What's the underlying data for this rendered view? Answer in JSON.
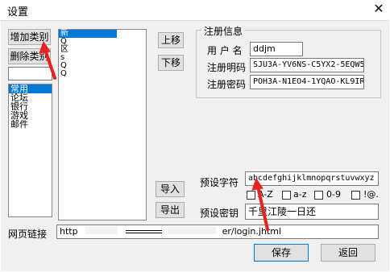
{
  "window": {
    "title": "设置",
    "close_glyph": "✕"
  },
  "buttons": {
    "add_category": "增加类别",
    "delete_category": "删除类别",
    "move_up": "上移",
    "move_down": "下移",
    "import": "导入",
    "export": "导出",
    "save": "保存",
    "back": "返回"
  },
  "categories": [
    "常用",
    "论坛",
    "银行",
    "游戏",
    "邮件"
  ],
  "site_list": {
    "items": [
      "新",
      "Q",
      "区",
      "s",
      "Q",
      "Q"
    ],
    "selected_index": 0
  },
  "registration": {
    "group_title": "注册信息",
    "username_label": "用 户 名",
    "username_value": "ddjm",
    "plain_label": "注册明码",
    "plain_value": "SJU3A-YV6NS-C5YX2-5EQW5",
    "secret_label": "注册密码",
    "secret_value": "POH3A-N1EO4-1YQAO-KL9IR"
  },
  "preset": {
    "chars_label": "预设字符",
    "chars_value": "abcdefghijklmnopqrstuvwxyz",
    "options": [
      "A-Z",
      "a-z",
      "0-9",
      "!@."
    ],
    "key_label": "预设密钥",
    "key_value": "千里江陵一日还"
  },
  "url": {
    "label": "网页链接",
    "value_start": "http",
    "value_end": "er/login.jhtml"
  },
  "colors": {
    "accent": "#0078d7",
    "annotation_arrow": "#e8221f"
  }
}
